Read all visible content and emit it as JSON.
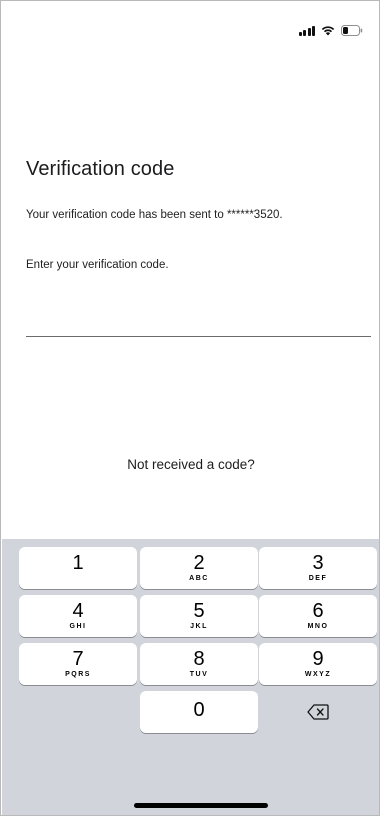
{
  "screen": {
    "title": "Verification code",
    "sent_message": "Your verification code has been sent to ******3520.",
    "instruction": "Enter your verification code.",
    "code_input": {
      "value": "",
      "placeholder": ""
    },
    "resend_link": "Not received a code?"
  },
  "keypad": {
    "keys": [
      {
        "digit": "1",
        "letters": ""
      },
      {
        "digit": "2",
        "letters": "ABC"
      },
      {
        "digit": "3",
        "letters": "DEF"
      },
      {
        "digit": "4",
        "letters": "GHI"
      },
      {
        "digit": "5",
        "letters": "JKL"
      },
      {
        "digit": "6",
        "letters": "MNO"
      },
      {
        "digit": "7",
        "letters": "PQRS"
      },
      {
        "digit": "8",
        "letters": "TUV"
      },
      {
        "digit": "9",
        "letters": "WXYZ"
      },
      {
        "digit": "0",
        "letters": ""
      }
    ],
    "delete_icon": "delete-backspace-icon"
  },
  "colors": {
    "keyboard_bg": "#d1d4da",
    "key_bg": "#ffffff",
    "text": "#1c1c1e"
  }
}
